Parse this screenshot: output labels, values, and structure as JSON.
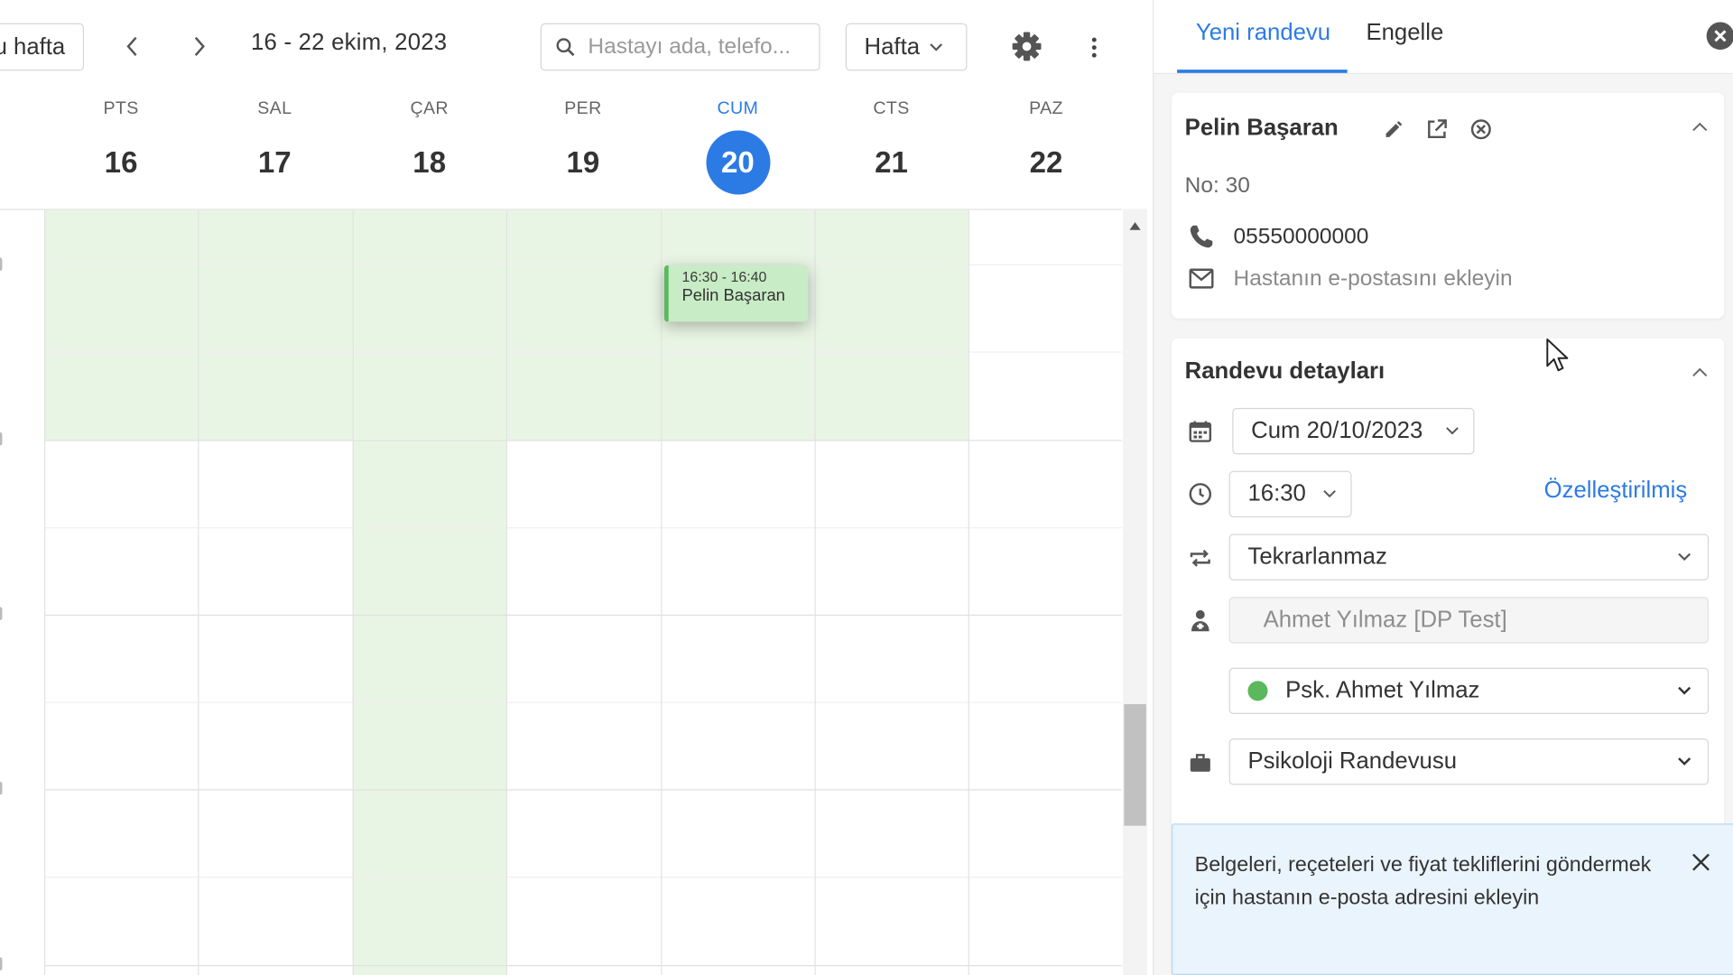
{
  "calendar": {
    "today_button": "u hafta",
    "date_range": "16 - 22 ekim, 2023",
    "search_placeholder": "Hastayı ada, telefo...",
    "view_select": "Hafta",
    "days": [
      {
        "name": "PTS",
        "num": "16"
      },
      {
        "name": "SAL",
        "num": "17"
      },
      {
        "name": "ÇAR",
        "num": "18"
      },
      {
        "name": "PER",
        "num": "19"
      },
      {
        "name": "CUM",
        "num": "20",
        "today": true
      },
      {
        "name": "CTS",
        "num": "21"
      },
      {
        "name": "PAZ",
        "num": "22"
      }
    ],
    "event": {
      "time": "16:30 - 16:40",
      "name": "Pelin Başaran",
      "color": "#c8ecc5",
      "accent": "#5cb85c"
    },
    "colors": {
      "today": "#2c7be5",
      "available": "#e8f5e4"
    }
  },
  "panel": {
    "tabs": [
      {
        "label": "Yeni randevu",
        "active": true
      },
      {
        "label": "Engelle",
        "active": false
      }
    ],
    "patient": {
      "name": "Pelin Başaran",
      "number": "No: 30",
      "phone": "05550000000",
      "email_placeholder": "Hastanın e-postasını ekleyin"
    },
    "details": {
      "title": "Randevu detayları",
      "date": "Cum 20/10/2023",
      "time": "16:30",
      "custom_link": "Özelleştirilmiş",
      "repeat": "Tekrarlanmaz",
      "doctor_placeholder": "Ahmet Yılmaz [DP Test]",
      "doctor_select": "Psk. Ahmet Yılmaz",
      "service": "Psikoloji Randevusu"
    },
    "notice": "Belgeleri, reçeteleri ve fiyat tekliflerini göndermek için hastanın e-posta adresini ekleyin"
  },
  "icons": [
    "chevron-left-icon",
    "chevron-right-icon",
    "search-icon",
    "chevron-down-icon",
    "gear-icon",
    "more-vertical-icon",
    "close-circle-icon",
    "pencil-icon",
    "external-link-icon",
    "cancel-circle-icon",
    "chevron-up-icon",
    "phone-icon",
    "mail-icon",
    "calendar-icon",
    "clock-icon",
    "repeat-icon",
    "doctor-icon",
    "briefcase-icon",
    "close-icon",
    "mouse-cursor-icon"
  ]
}
